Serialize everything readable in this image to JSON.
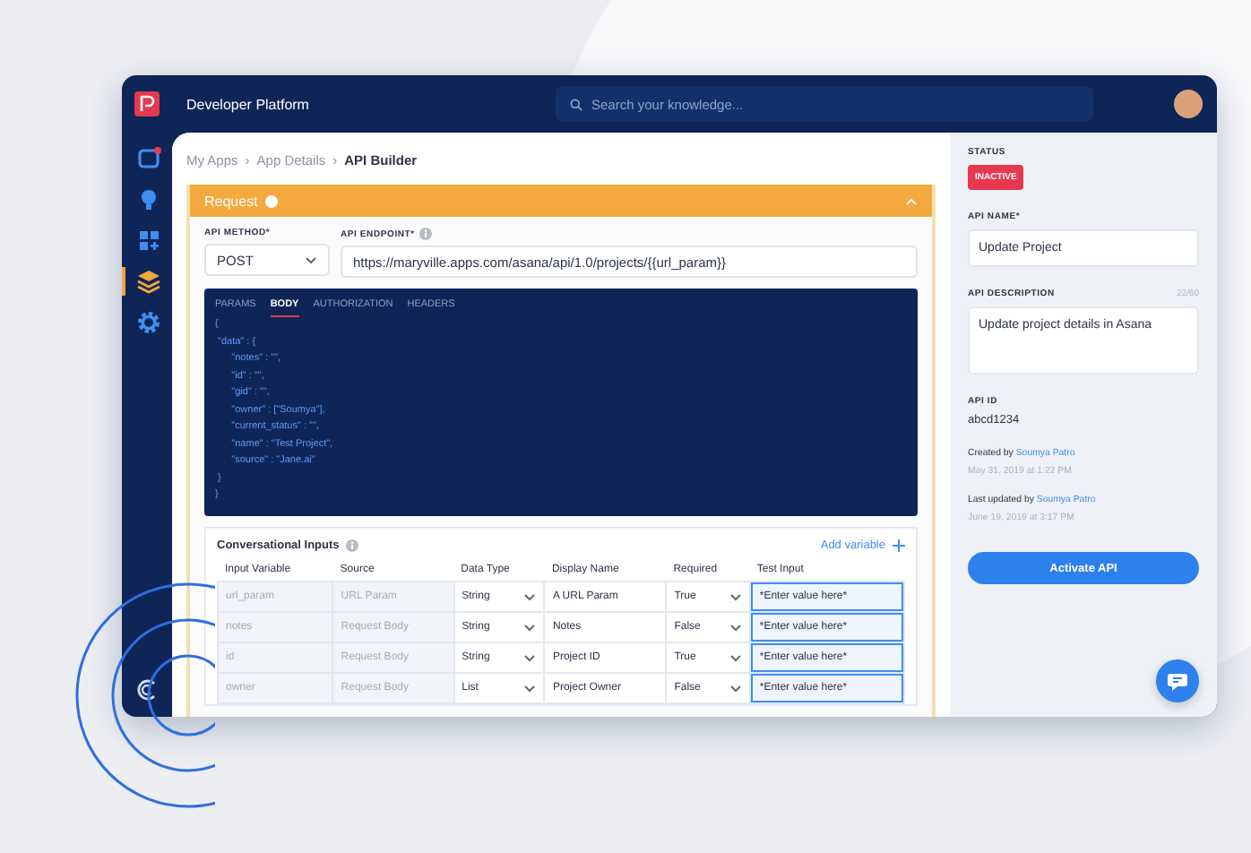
{
  "window": {
    "title": "Developer Platform"
  },
  "search": {
    "placeholder": "Search your knowledge..."
  },
  "sidebar": {
    "items": [
      {
        "kind": "inbox",
        "selected": false
      },
      {
        "kind": "bulb",
        "selected": false
      },
      {
        "kind": "apps",
        "selected": false
      },
      {
        "kind": "layers",
        "selected": true
      },
      {
        "kind": "gear",
        "selected": false
      }
    ]
  },
  "breadcrumb": {
    "separator": "›",
    "items": [
      {
        "label": "My Apps",
        "selected": false
      },
      {
        "label": "App Details",
        "selected": false
      },
      {
        "label": "API Builder",
        "selected": true
      }
    ]
  },
  "request": {
    "title": "Request",
    "expanded": true,
    "method": {
      "label": "API METHOD*",
      "value": "POST"
    },
    "endpoint": {
      "label": "API ENDPOINT*",
      "value": "https://maryville.apps.com/asana/api/1.0/projects/{{url_param}}"
    },
    "tabs": [
      {
        "label": "PARAMS",
        "selected": false
      },
      {
        "label": "BODY",
        "selected": true
      },
      {
        "label": "AUTHORIZATION",
        "selected": false
      },
      {
        "label": "HEADERS",
        "selected": false
      }
    ],
    "code_lines": [
      "{",
      " \"data\" : {",
      "      \"notes\" : \"\",",
      "      \"id\" : \"\",",
      "      \"gid\" : \"\",",
      "      \"owner\" : [\"Soumya\"],",
      "      \"current_status\" : \"\",",
      "      \"name\" : \"Test Project\",",
      "      \"source\" : \"Jane.ai\"",
      " }",
      "}"
    ]
  },
  "inputs": {
    "title": "Conversational Inputs",
    "add_label": "Add variable",
    "columns": [
      "Input Variable",
      "Source",
      "Data Type",
      "Display Name",
      "Required",
      "Test Input"
    ],
    "rows": [
      {
        "variable": "url_param",
        "source": "URL Param",
        "data_type": "String",
        "display_name": "A URL Param",
        "required": "True",
        "test_input": "*Enter value here*"
      },
      {
        "variable": "notes",
        "source": "Request Body",
        "data_type": "String",
        "display_name": "Notes",
        "required": "False",
        "test_input": "*Enter value here*"
      },
      {
        "variable": "id",
        "source": "Request Body",
        "data_type": "String",
        "display_name": "Project ID",
        "required": "True",
        "test_input": "*Enter value here*"
      },
      {
        "variable": "owner",
        "source": "Request Body",
        "data_type": "List",
        "display_name": "Project Owner",
        "required": "False",
        "test_input": "*Enter value here*"
      }
    ]
  },
  "details": {
    "status_label": "STATUS",
    "status": "INACTIVE",
    "name_label": "API NAME*",
    "name": "Update Project",
    "description_label": "API DESCRIPTION",
    "description_count": "22/60",
    "description": "Update project details in Asana",
    "id_label": "API ID",
    "id": "abcd1234",
    "created_text": "Created by",
    "created_by": "Soumya Patro",
    "created_date": "May 31, 2019 at 1:22 PM",
    "updated_text": "Last updated by",
    "updated_by": "Soumya Patro",
    "updated_date": "June 19, 2019 at 3:17 PM",
    "activate_button": "Activate API"
  }
}
